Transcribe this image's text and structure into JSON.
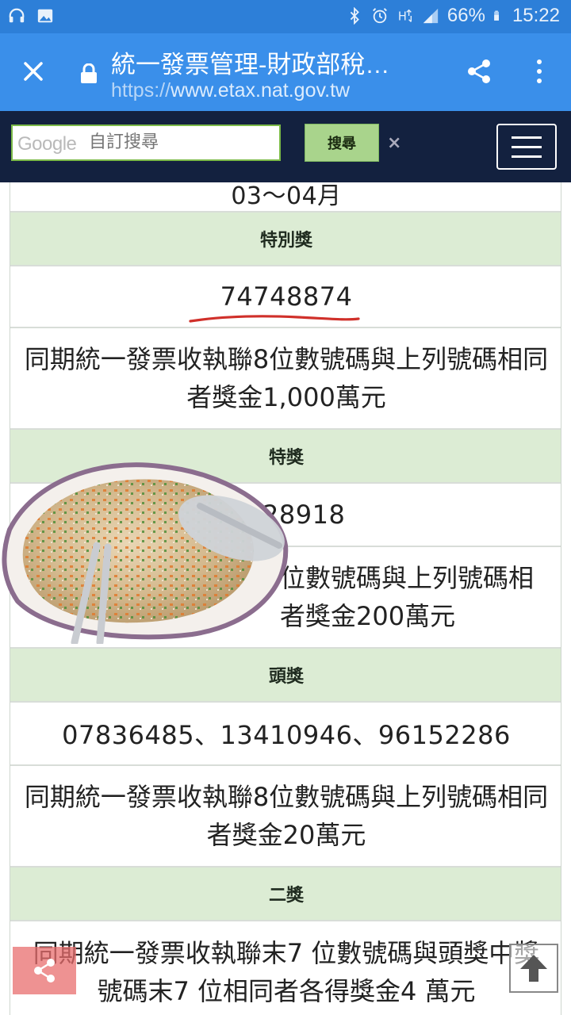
{
  "status_bar": {
    "battery": "66%",
    "time": "15:22",
    "icons": [
      "headphones-icon",
      "image-icon",
      "bluetooth-icon",
      "alarm-icon",
      "data-icon",
      "signal-icon",
      "battery-icon"
    ]
  },
  "browser": {
    "title": "統一發票管理-財政部稅…",
    "url_protocol": "https://",
    "url_host": "www.etax.nat.gov.tw"
  },
  "site_header": {
    "search_brand": "Google",
    "search_placeholder": "自訂搜尋",
    "search_button": "搜尋",
    "clear_symbol": "×"
  },
  "prize_table": {
    "period_partial": "03～04月",
    "rows": [
      {
        "kind": "header",
        "text": "特別獎"
      },
      {
        "kind": "number",
        "text": "74748874"
      },
      {
        "kind": "desc",
        "text": "同期統一發票收執聯8位數號碼與上列號碼相同者獎金1,000萬元"
      },
      {
        "kind": "header",
        "text": "特獎"
      },
      {
        "kind": "number",
        "text": "28918"
      },
      {
        "kind": "desc",
        "text": "位數號碼與上列號碼相\n者獎金200萬元"
      },
      {
        "kind": "header",
        "text": "頭獎"
      },
      {
        "kind": "number",
        "text": "07836485、13410946、96152286"
      },
      {
        "kind": "desc",
        "text": "同期統一發票收執聯8位數號碼與上列號碼相同者獎金20萬元"
      },
      {
        "kind": "header",
        "text": "二獎"
      },
      {
        "kind": "desc",
        "text": "同期統一發票收執聯末7 位數號碼與頭獎中獎號碼末7 位相同者各得獎金4 萬元"
      }
    ]
  },
  "colors": {
    "status_bar": "#2d7fd8",
    "toolbar": "#3a8fea",
    "site_header": "#13213f",
    "table_header": "#dcecd4",
    "underline_mark": "#d0302a"
  }
}
